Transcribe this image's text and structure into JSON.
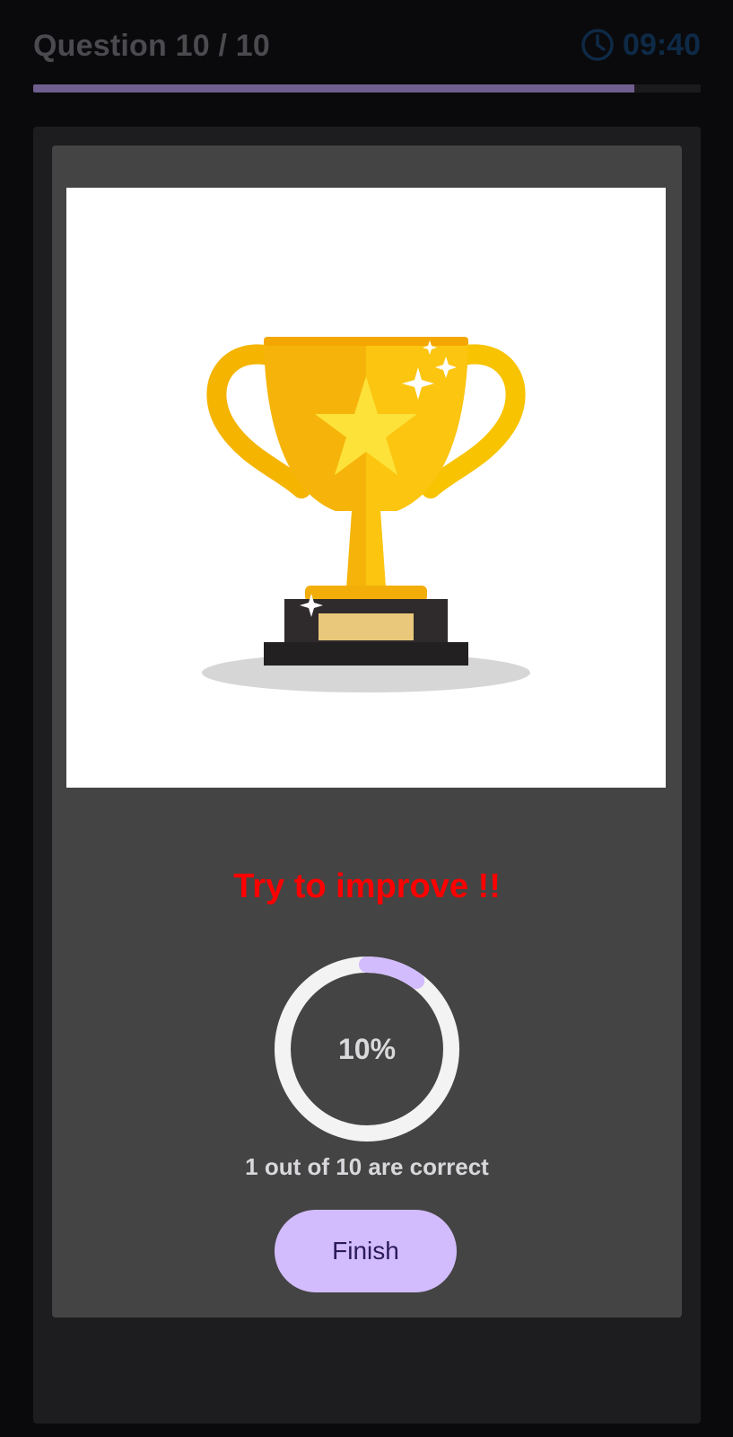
{
  "header": {
    "question_label": "Question 10 / 10",
    "timer_icon": "clock-icon",
    "timer_value": "09:40",
    "timer_color": "#0e2a47"
  },
  "progress": {
    "fraction": 0.9,
    "fill_color": "#6f5f8e"
  },
  "result": {
    "image": "trophy-icon",
    "message": "Try to improve !!",
    "message_color": "#ff0000",
    "score_percent_text": "10%",
    "score_fraction": 0.1,
    "ring_accent": "#d2bcfd",
    "score_summary": "1 out of 10 are correct"
  },
  "actions": {
    "finish_label": "Finish",
    "finish_color": "#d2bcfd"
  }
}
